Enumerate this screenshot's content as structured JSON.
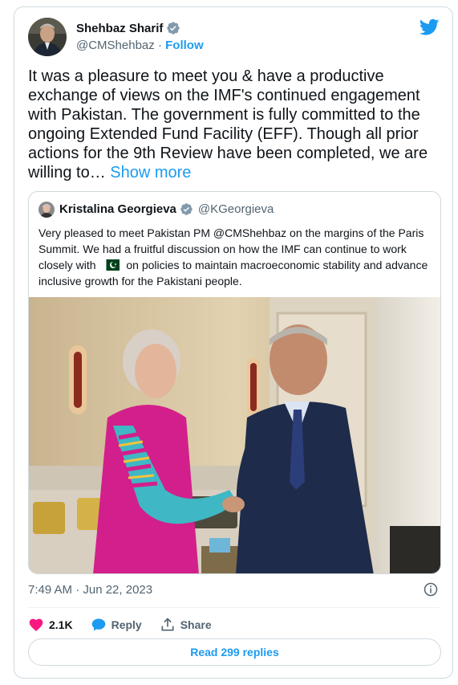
{
  "author": {
    "name": "Shehbaz Sharif",
    "handle": "@CMShehbaz",
    "separator": "·",
    "follow_label": "Follow"
  },
  "tweet": {
    "text": "It was a pleasure to meet you & have a productive exchange of views on the IMF's continued engagement with Pakistan. The government is fully committed to the ongoing Extended Fund Facility (EFF). Though all prior actions for the 9th Review have been completed, we are willing to…",
    "show_more_label": "Show more"
  },
  "quote": {
    "name": "Kristalina Georgieva",
    "handle": "@KGeorgieva",
    "text_before_flag": "Very pleased to meet Pakistan PM @CMShehbaz on the margins of the Paris Summit. We had a fruitful discussion on how the IMF can continue to work closely with",
    "text_after_flag": "on policies to maintain macroeconomic stability and advance inclusive growth for the Pakistani people.",
    "flag_icon": "pakistan-flag-icon"
  },
  "footer": {
    "timestamp": "7:49 AM · Jun 22, 2023",
    "likes": "2.1K",
    "reply_label": "Reply",
    "share_label": "Share",
    "read_replies_label": "Read 299 replies"
  },
  "colors": {
    "accent": "#1d9bf0",
    "like": "#f91880",
    "muted": "#536471"
  },
  "icons": [
    "twitter-bird-icon",
    "verified-badge-icon",
    "info-icon",
    "heart-icon",
    "reply-bubble-icon",
    "share-icon"
  ]
}
